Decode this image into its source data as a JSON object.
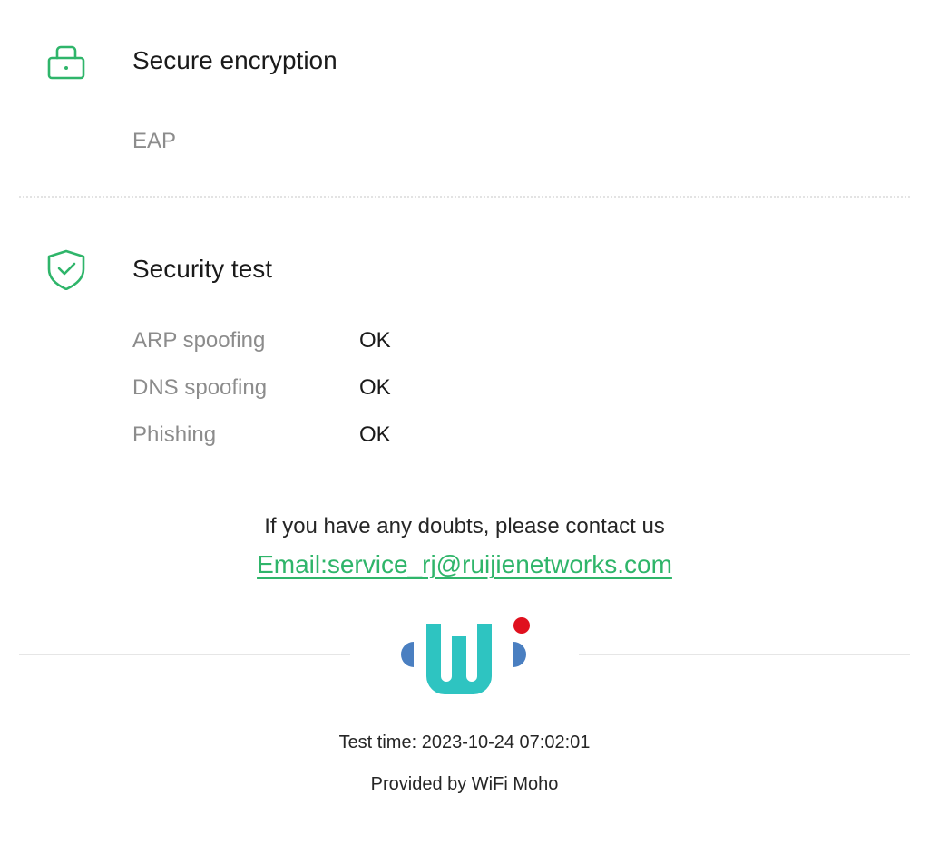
{
  "encryption": {
    "icon": "lock-icon",
    "title": "Secure encryption",
    "value": "EAP"
  },
  "security": {
    "icon": "shield-check-icon",
    "title": "Security test",
    "rows": [
      {
        "label": "ARP spoofing",
        "status": "OK"
      },
      {
        "label": "DNS spoofing",
        "status": "OK"
      },
      {
        "label": "Phishing",
        "status": "OK"
      }
    ]
  },
  "contact": {
    "message": "If you have any doubts, please contact us",
    "email": "Email:service_rj@ruijienetworks.com"
  },
  "logo": {
    "icon": "wifi-moho-logo"
  },
  "footer": {
    "test_time": "Test time: 2023-10-24 07:02:01",
    "provided_by": "Provided by WiFi Moho"
  },
  "colors": {
    "accent": "#2fb56a",
    "logo_teal": "#2ec4c1",
    "logo_blue": "#4a7fc1",
    "logo_red": "#e0101e"
  }
}
